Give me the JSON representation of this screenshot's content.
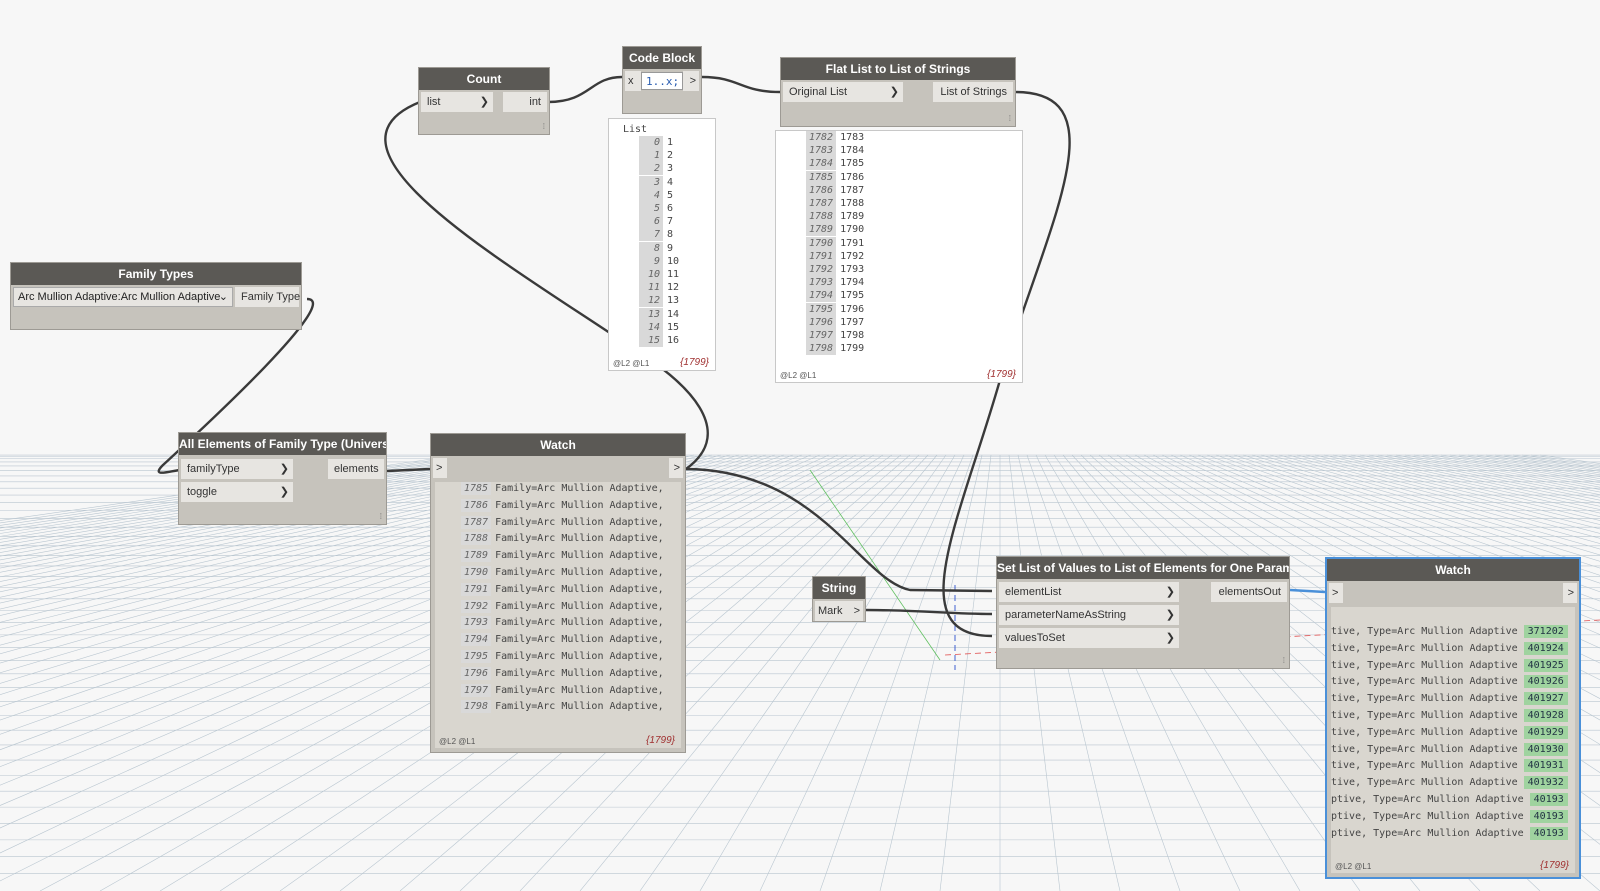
{
  "nodes": {
    "count": {
      "title": "Count",
      "in": "list",
      "out": "int"
    },
    "code_block": {
      "title": "Code Block",
      "port_in": "x",
      "code": "1..x;",
      "port_out": ">"
    },
    "flat_list": {
      "title": "Flat List to List of Strings",
      "in": "Original List",
      "out": "List of Strings"
    },
    "family_types": {
      "title": "Family Types",
      "selected": "Arc Mullion Adaptive:Arc Mullion Adaptive",
      "out": "Family Type"
    },
    "all_elements": {
      "title": "All Elements of Family Type (Universal)",
      "in1": "familyType",
      "in2": "toggle",
      "out": "elements"
    },
    "watch1": {
      "title": "Watch",
      "in": ">",
      "out": ">",
      "footer": "@L2 @L1",
      "count": "{1799}"
    },
    "string": {
      "title": "String",
      "value": "Mark",
      "out": ">"
    },
    "set_list": {
      "title": "Set List of Values to List of Elements for One Parameter",
      "in1": "elementList",
      "in2": "parameterNameAsString",
      "in3": "valuesToSet",
      "out": "elementsOut"
    },
    "watch2": {
      "title": "Watch",
      "in": ">",
      "out": ">",
      "footer": "@L2 @L1",
      "count": "{1799}"
    }
  },
  "code_preview": {
    "header": "List",
    "rows": [
      {
        "i": "0",
        "v": "1"
      },
      {
        "i": "1",
        "v": "2"
      },
      {
        "i": "2",
        "v": "3"
      },
      {
        "i": "3",
        "v": "4"
      },
      {
        "i": "4",
        "v": "5"
      },
      {
        "i": "5",
        "v": "6"
      },
      {
        "i": "6",
        "v": "7"
      },
      {
        "i": "7",
        "v": "8"
      },
      {
        "i": "8",
        "v": "9"
      },
      {
        "i": "9",
        "v": "10"
      },
      {
        "i": "10",
        "v": "11"
      },
      {
        "i": "11",
        "v": "12"
      },
      {
        "i": "12",
        "v": "13"
      },
      {
        "i": "13",
        "v": "14"
      },
      {
        "i": "14",
        "v": "15"
      },
      {
        "i": "15",
        "v": "16"
      }
    ],
    "footer": "@L2 @L1",
    "count": "{1799}"
  },
  "flat_preview": {
    "rows": [
      {
        "i": "1782",
        "v": "1783"
      },
      {
        "i": "1783",
        "v": "1784"
      },
      {
        "i": "1784",
        "v": "1785"
      },
      {
        "i": "1785",
        "v": "1786"
      },
      {
        "i": "1786",
        "v": "1787"
      },
      {
        "i": "1787",
        "v": "1788"
      },
      {
        "i": "1788",
        "v": "1789"
      },
      {
        "i": "1789",
        "v": "1790"
      },
      {
        "i": "1790",
        "v": "1791"
      },
      {
        "i": "1791",
        "v": "1792"
      },
      {
        "i": "1792",
        "v": "1793"
      },
      {
        "i": "1793",
        "v": "1794"
      },
      {
        "i": "1794",
        "v": "1795"
      },
      {
        "i": "1795",
        "v": "1796"
      },
      {
        "i": "1796",
        "v": "1797"
      },
      {
        "i": "1797",
        "v": "1798"
      },
      {
        "i": "1798",
        "v": "1799"
      }
    ],
    "footer": "@L2 @L1",
    "count": "{1799}"
  },
  "watch1_rows": [
    {
      "i": "1785",
      "v": "Family=Arc Mullion Adaptive,"
    },
    {
      "i": "1786",
      "v": "Family=Arc Mullion Adaptive,"
    },
    {
      "i": "1787",
      "v": "Family=Arc Mullion Adaptive,"
    },
    {
      "i": "1788",
      "v": "Family=Arc Mullion Adaptive,"
    },
    {
      "i": "1789",
      "v": "Family=Arc Mullion Adaptive,"
    },
    {
      "i": "1790",
      "v": "Family=Arc Mullion Adaptive,"
    },
    {
      "i": "1791",
      "v": "Family=Arc Mullion Adaptive,"
    },
    {
      "i": "1792",
      "v": "Family=Arc Mullion Adaptive,"
    },
    {
      "i": "1793",
      "v": "Family=Arc Mullion Adaptive,"
    },
    {
      "i": "1794",
      "v": "Family=Arc Mullion Adaptive,"
    },
    {
      "i": "1795",
      "v": "Family=Arc Mullion Adaptive,"
    },
    {
      "i": "1796",
      "v": "Family=Arc Mullion Adaptive,"
    },
    {
      "i": "1797",
      "v": "Family=Arc Mullion Adaptive,"
    },
    {
      "i": "1798",
      "v": "Family=Arc Mullion Adaptive,"
    }
  ],
  "watch2_rows": [
    {
      "t": "tive, Type=Arc Mullion Adaptive",
      "id": "371202"
    },
    {
      "t": "tive, Type=Arc Mullion Adaptive",
      "id": "401924"
    },
    {
      "t": "tive, Type=Arc Mullion Adaptive",
      "id": "401925"
    },
    {
      "t": "tive, Type=Arc Mullion Adaptive",
      "id": "401926"
    },
    {
      "t": "tive, Type=Arc Mullion Adaptive",
      "id": "401927"
    },
    {
      "t": "tive, Type=Arc Mullion Adaptive",
      "id": "401928"
    },
    {
      "t": "tive, Type=Arc Mullion Adaptive",
      "id": "401929"
    },
    {
      "t": "tive, Type=Arc Mullion Adaptive",
      "id": "401930"
    },
    {
      "t": "tive, Type=Arc Mullion Adaptive",
      "id": "401931"
    },
    {
      "t": "tive, Type=Arc Mullion Adaptive",
      "id": "401932"
    },
    {
      "t": "ptive, Type=Arc Mullion Adaptive",
      "id": "40193"
    },
    {
      "t": "ptive, Type=Arc Mullion Adaptive",
      "id": "40193"
    },
    {
      "t": "ptive, Type=Arc Mullion Adaptive",
      "id": "40193"
    }
  ],
  "colors": {
    "node_header": "#5b5955",
    "node_body": "#c6c3bc",
    "selected_border": "#4a90d9",
    "wire": "#3a3a3a",
    "element_id": "#9fd39f"
  }
}
